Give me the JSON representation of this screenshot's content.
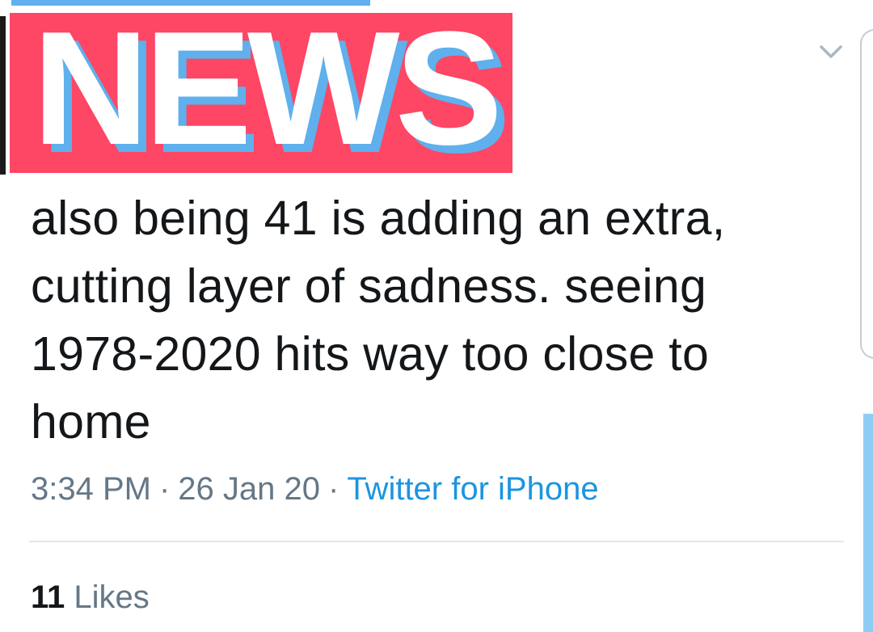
{
  "banner": {
    "text": "NEWS",
    "background_color": "#fe4665",
    "shadow_color": "#5fb0ec",
    "text_color": "#ffffff"
  },
  "tweet": {
    "text": "also being 41 is adding an extra, cutting layer of sadness. seeing 1978-2020 hits way too close to home",
    "time": "3:34 PM",
    "date": "26 Jan 20",
    "separator": "·",
    "source": "Twitter for iPhone",
    "likes_count": "11",
    "likes_label": "Likes"
  },
  "icons": {
    "menu": "chevron-down-icon"
  },
  "colors": {
    "text": "#14171a",
    "meta": "#657786",
    "link": "#1b95e0",
    "divider": "#e1e8ed"
  }
}
